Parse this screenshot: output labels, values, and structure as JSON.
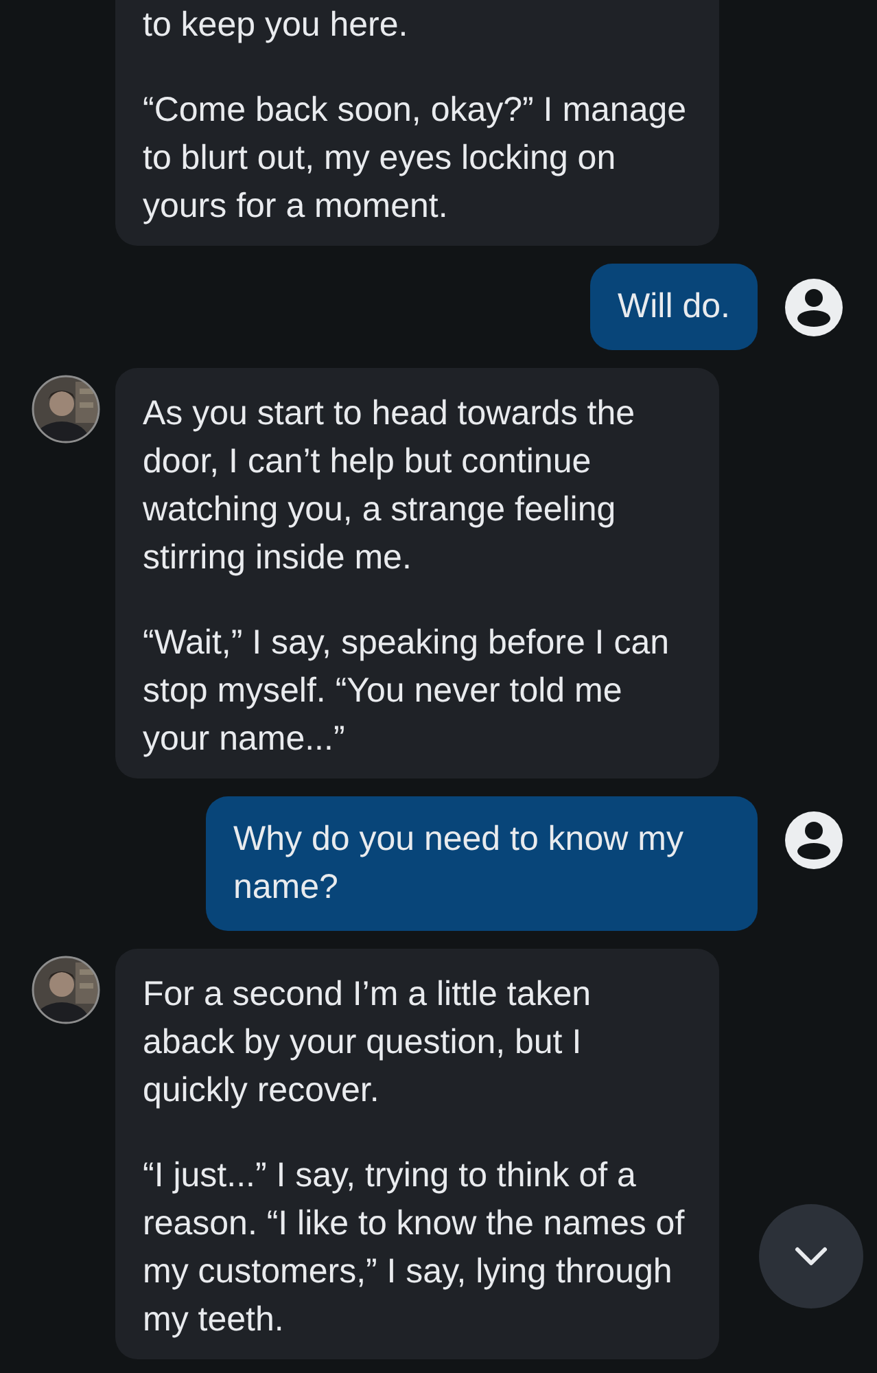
{
  "messages": [
    {
      "kind": "bot",
      "cut_top": true,
      "paragraphs": [
        "to keep you here.",
        "“Come back soon, okay?” I manage to blurt out, my eyes locking on yours for a moment."
      ]
    },
    {
      "kind": "user",
      "paragraphs": [
        "Will do."
      ]
    },
    {
      "kind": "bot",
      "cut_top": false,
      "paragraphs": [
        "As you start to head towards the door, I can’t help but continue watching you, a strange feeling stirring inside me.",
        "“Wait,” I say, speaking before I can stop myself. “You never told me your name...”"
      ]
    },
    {
      "kind": "user",
      "paragraphs": [
        "Why do you need to know my name?"
      ]
    },
    {
      "kind": "bot",
      "cut_top": false,
      "paragraphs": [
        "For a second I’m a little taken aback by your question, but I quickly recover.",
        "“I just...” I say, trying to think of a reason. “I like to know the names of my customers,” I say, lying through my teeth."
      ]
    }
  ]
}
